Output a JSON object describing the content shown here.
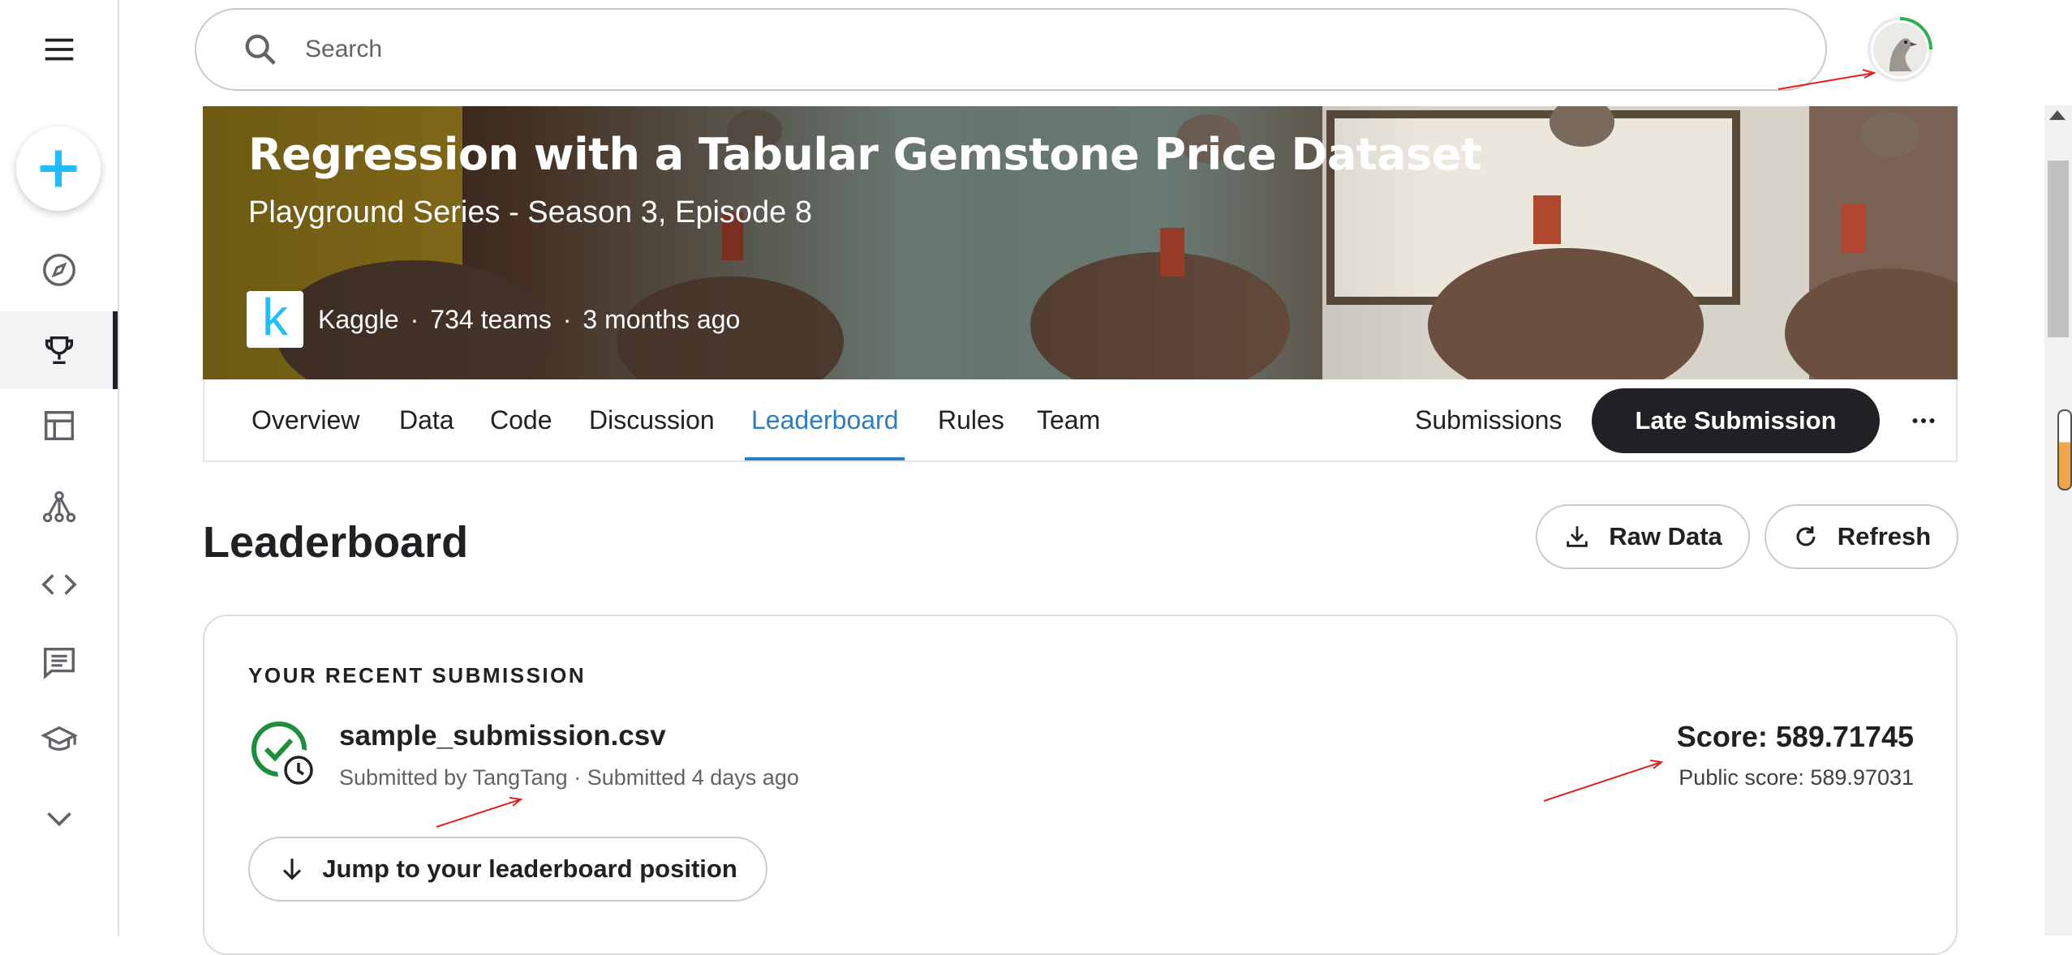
{
  "sidebar": {
    "items": [
      {
        "name": "menu-icon"
      },
      {
        "name": "compass-icon"
      },
      {
        "name": "trophy-icon"
      },
      {
        "name": "table-icon"
      },
      {
        "name": "models-icon"
      },
      {
        "name": "code-icon"
      },
      {
        "name": "discussion-icon"
      },
      {
        "name": "learn-icon"
      },
      {
        "name": "chevron-down-icon"
      }
    ],
    "active_item": "trophy-icon"
  },
  "search": {
    "placeholder": "Search"
  },
  "banner": {
    "title": "Regression with a Tabular Gemstone Price Dataset",
    "subtitle": "Playground Series - Season 3, Episode 8",
    "host": "Kaggle",
    "teams": "734 teams",
    "age": "3 months ago"
  },
  "tabs": {
    "items": [
      "Overview",
      "Data",
      "Code",
      "Discussion",
      "Leaderboard",
      "Rules",
      "Team"
    ],
    "active": "Leaderboard",
    "submissions_label": "Submissions",
    "late_submission_label": "Late Submission"
  },
  "leaderboard": {
    "title": "Leaderboard",
    "raw_data_label": "Raw Data",
    "refresh_label": "Refresh"
  },
  "recent_submission": {
    "section_label": "YOUR RECENT SUBMISSION",
    "file_name": "sample_submission.csv",
    "meta": "Submitted by TangTang · Submitted 4 days ago",
    "score": "Score: 589.71745",
    "public_score": "Public score: 589.97031",
    "jump_label": "Jump to your leaderboard position"
  },
  "colors": {
    "accent": "#2a7ec1",
    "create_plus": "#20beff",
    "success": "#1e8e3e",
    "dark_button": "#202124"
  }
}
